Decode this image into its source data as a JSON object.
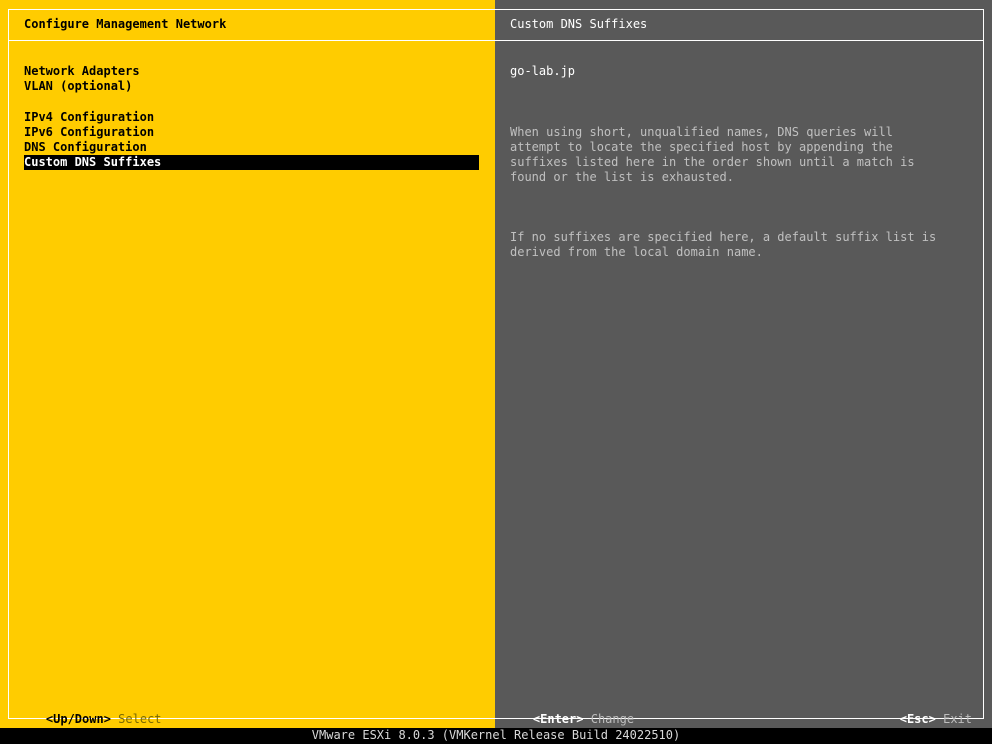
{
  "left_panel": {
    "title": "Configure Management Network",
    "menu": [
      {
        "label": "Network Adapters",
        "selected": false
      },
      {
        "label": "VLAN (optional)",
        "selected": false
      },
      {
        "label": "IPv4 Configuration",
        "selected": false
      },
      {
        "label": "IPv6 Configuration",
        "selected": false
      },
      {
        "label": "DNS Configuration",
        "selected": false
      },
      {
        "label": "Custom DNS Suffixes",
        "selected": true
      }
    ],
    "footer": {
      "key": "<Up/Down>",
      "action": "Select"
    }
  },
  "right_panel": {
    "title": "Custom DNS Suffixes",
    "value": "go-lab.jp",
    "description_1": "When using short, unqualified names, DNS queries will\nattempt to locate the specified host by appending the\nsuffixes listed here in the order shown until a match is\nfound or the list is exhausted.",
    "description_2": "If no suffixes are specified here, a default suffix list is\nderived from the local domain name.",
    "footer_enter": {
      "key": "<Enter>",
      "action": "Change"
    },
    "footer_esc": {
      "key": "<Esc>",
      "action": "Exit"
    }
  },
  "status_bar": "VMware ESXi 8.0.3 (VMKernel Release Build 24022510)",
  "colors": {
    "left_bg": "#ffcc00",
    "right_bg": "#595959",
    "selection_bg": "#000000",
    "screen_bg": "#000000"
  }
}
